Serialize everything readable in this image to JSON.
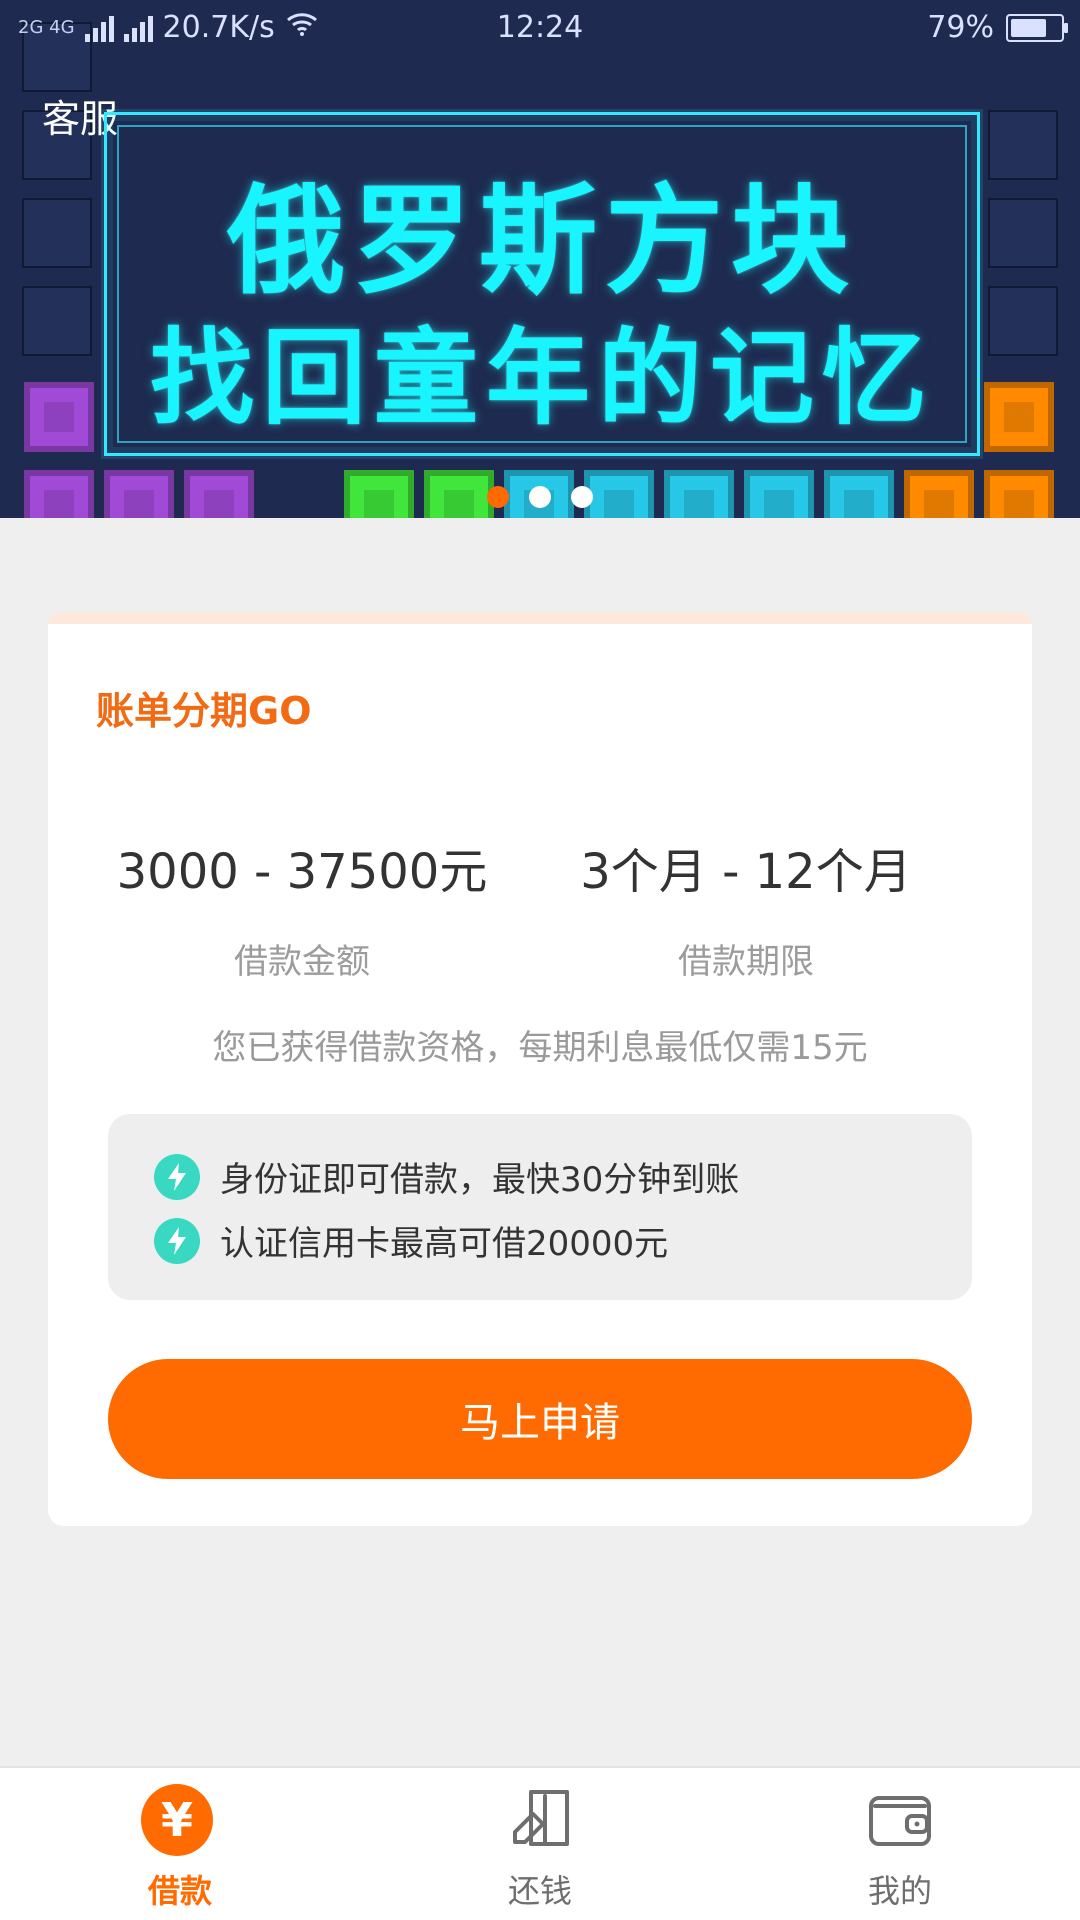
{
  "status_bar": {
    "network": "2G 4G",
    "speed": "20.7K/s",
    "time": "12:24",
    "battery": "79%",
    "battery_level": 0.79
  },
  "banner": {
    "kefu": "客服",
    "title_line1": "俄罗斯方块",
    "title_line2": "找回童年的记忆",
    "dots_total": 3,
    "active_dot": 0,
    "accent_color": "#18f5ff"
  },
  "card": {
    "title": "账单分期GO",
    "amount": {
      "value": "3000 - 37500元",
      "label": "借款金额"
    },
    "term": {
      "value": "3个月 - 12个月",
      "label": "借款期限"
    },
    "note": "您已获得借款资格，每期利息最低仅需15元",
    "features": [
      {
        "text": "身份证即可借款，最快30分钟到账",
        "icon": "bolt-icon"
      },
      {
        "text": "认证信用卡最高可借20000元",
        "icon": "bolt-icon"
      }
    ],
    "apply_label": "马上申请",
    "brand_color": "#ff6b00"
  },
  "bottom_nav": {
    "items": [
      {
        "label": "借款",
        "icon": "yuan-icon",
        "active": true
      },
      {
        "label": "还钱",
        "icon": "repay-icon",
        "active": false
      },
      {
        "label": "我的",
        "icon": "wallet-icon",
        "active": false
      }
    ]
  }
}
